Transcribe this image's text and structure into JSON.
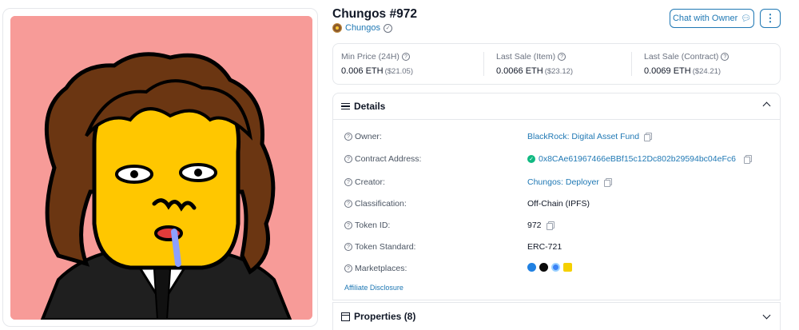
{
  "nft": {
    "title": "Chungos #972",
    "collection": "Chungos"
  },
  "buttons": {
    "chat": "Chat with Owner",
    "more": "⋮"
  },
  "stats": [
    {
      "label": "Min Price (24H)",
      "eth": "0.006 ETH",
      "usd": "($21.05)"
    },
    {
      "label": "Last Sale (Item)",
      "eth": "0.0066 ETH",
      "usd": "($23.12)"
    },
    {
      "label": "Last Sale (Contract)",
      "eth": "0.0069 ETH",
      "usd": "($24.21)"
    }
  ],
  "details": {
    "heading": "Details",
    "rows": [
      {
        "label": "Owner:",
        "value": "BlackRock: Digital Asset Fund"
      },
      {
        "label": "Contract Address:",
        "value": "0x8CAe61967466eBBf15c12Dc802b29594bc04eFc6"
      },
      {
        "label": "Creator:",
        "value": "Chungos: Deployer"
      },
      {
        "label": "Classification:",
        "value": "Off-Chain (IPFS)"
      },
      {
        "label": "Token ID:",
        "value": "972"
      },
      {
        "label": "Token Standard:",
        "value": "ERC-721"
      },
      {
        "label": "Marketplaces:",
        "value": ""
      }
    ],
    "affiliate": "Affiliate Disclosure",
    "marketplace_icons": [
      "opensea-icon",
      "rarible-icon",
      "looksrare-icon",
      "blur-icon"
    ]
  },
  "properties": {
    "heading": "Properties (8)"
  },
  "colors": {
    "link": "#1f78b4",
    "art_background": "#f79b98",
    "verified_green": "#10b981"
  }
}
